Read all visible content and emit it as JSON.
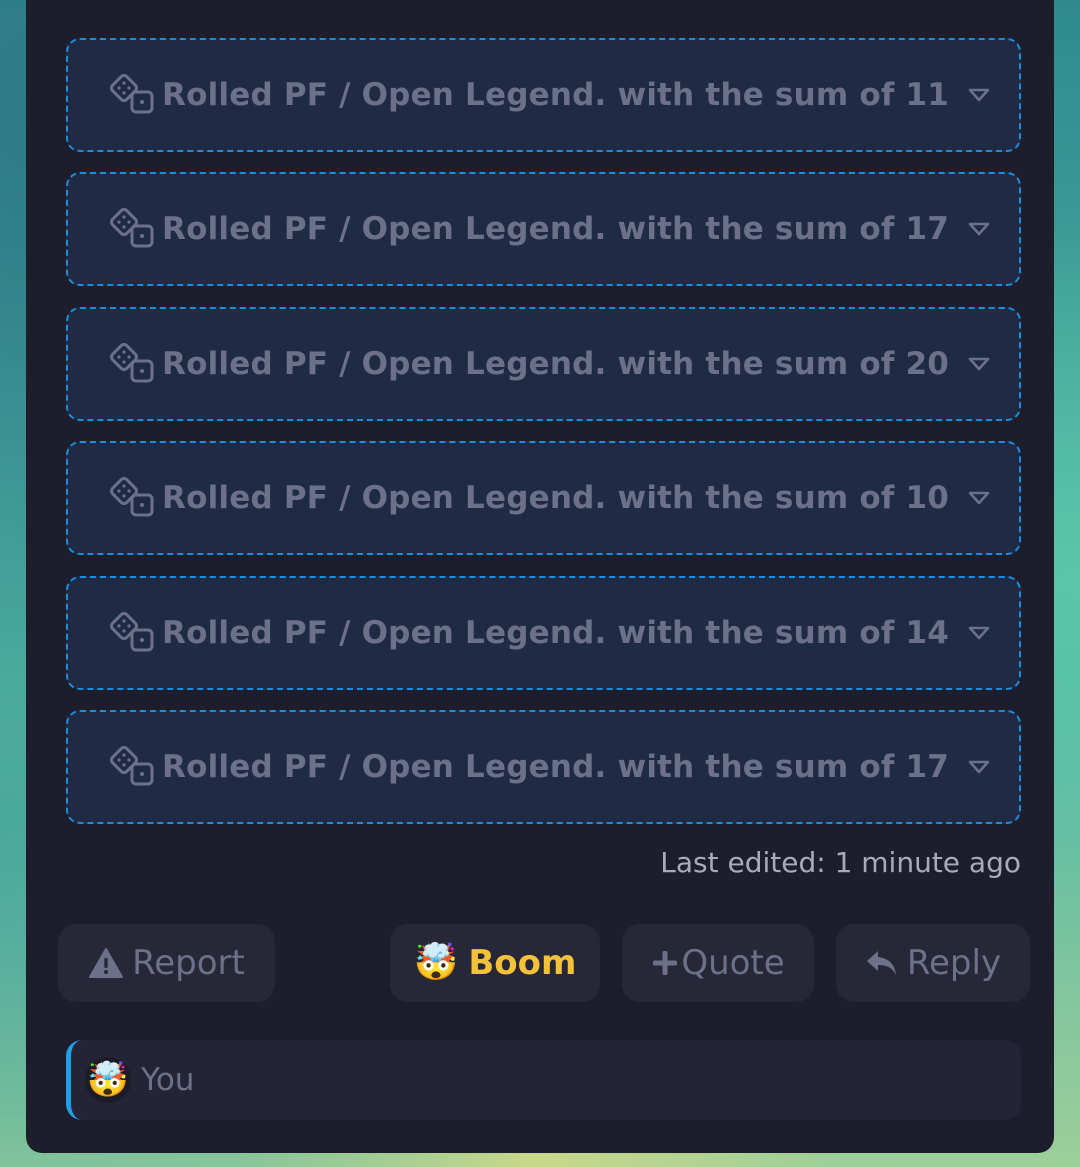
{
  "rolls": [
    {
      "label": "Rolled PF / Open Legend. with the sum of 11"
    },
    {
      "label": "Rolled PF / Open Legend. with the sum of 17"
    },
    {
      "label": "Rolled PF / Open Legend. with the sum of 20"
    },
    {
      "label": "Rolled PF / Open Legend. with the sum of 10"
    },
    {
      "label": "Rolled PF / Open Legend. with the sum of 14"
    },
    {
      "label": "Rolled PF / Open Legend. with the sum of 17"
    }
  ],
  "last_edited": "Last edited: 1 minute ago",
  "actions": {
    "report_label": "Report",
    "boom_emoji": "🤯",
    "boom_label": "Boom",
    "quote_label": "Quote",
    "reply_label": "Reply"
  },
  "reaction": {
    "emoji": "🤯",
    "user": "You"
  },
  "colors": {
    "panel": "#1d1d2b",
    "roll_border": "#1a8fe0",
    "roll_bg": "#1f2b45",
    "muted_text": "#6c7189",
    "boom_accent": "#f4c13b",
    "reaction_accent": "#1da0e8"
  },
  "icons": {
    "roll": "dice-icon",
    "expand": "caret-down-icon",
    "report": "warning-icon",
    "quote": "plus-icon",
    "reply": "reply-icon"
  }
}
